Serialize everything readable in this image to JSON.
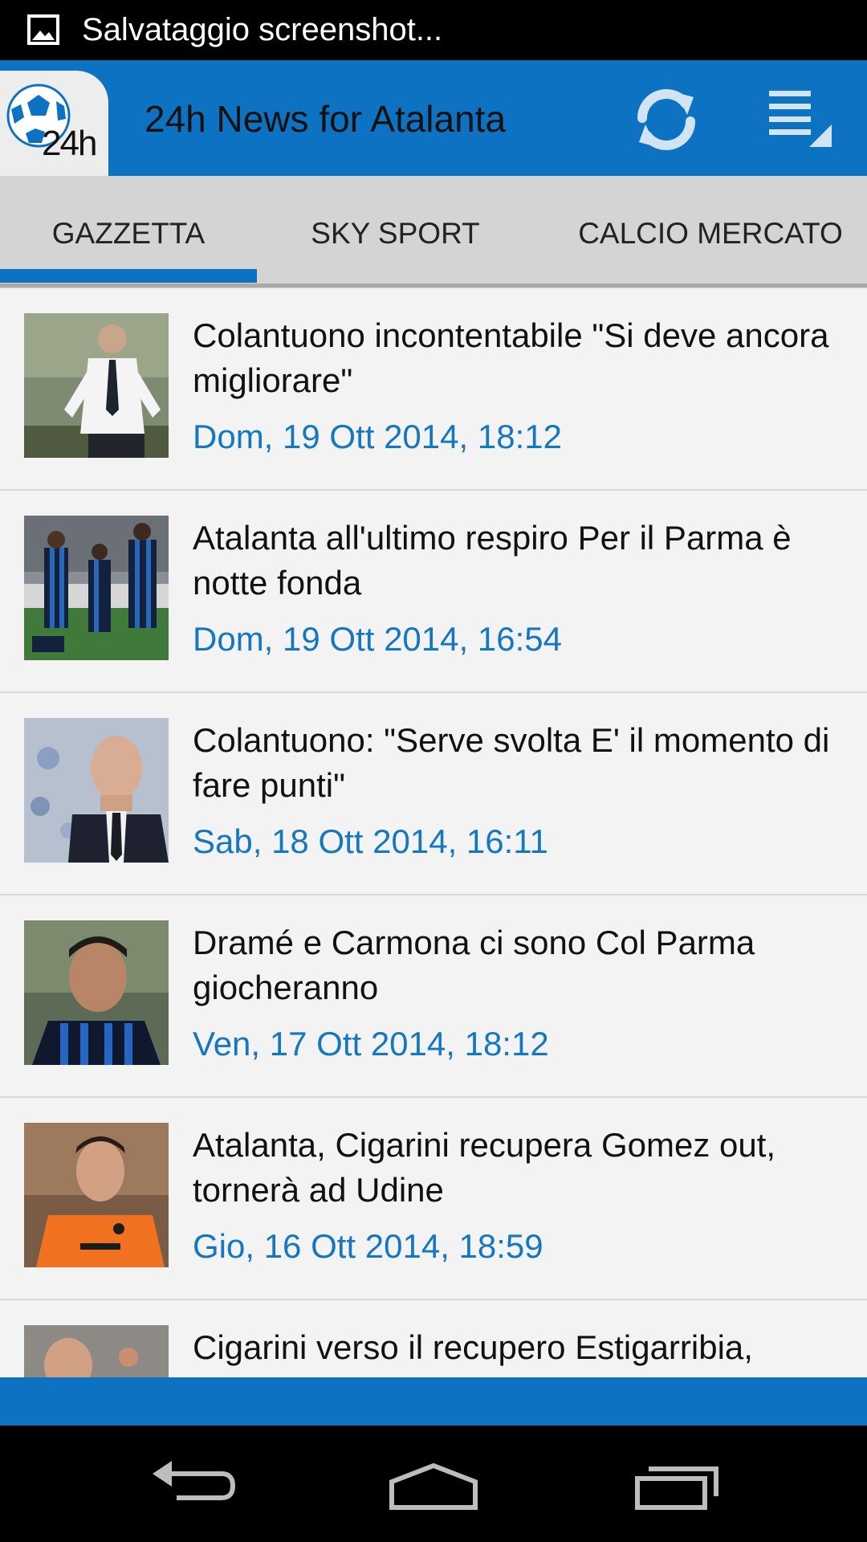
{
  "status_bar": {
    "icon": "image-icon",
    "text": "Salvataggio screenshot..."
  },
  "app_bar": {
    "logo_text": "24h",
    "title": "24h News for Atalanta",
    "refresh_icon": "refresh-icon",
    "menu_icon": "overflow-menu-icon"
  },
  "tabs": [
    {
      "label": "GAZZETTA",
      "selected": true
    },
    {
      "label": "SKY SPORT",
      "selected": false
    },
    {
      "label": "CALCIO MERCATO",
      "selected": false
    }
  ],
  "articles": [
    {
      "headline": " Colantuono incontentabile \"Si deve ancora migliorare\"",
      "date": "Dom, 19 Ott 2014, 18:12"
    },
    {
      "headline": "Atalanta all'ultimo respiro Per il Parma è notte fonda",
      "date": "Dom, 19 Ott 2014, 16:54"
    },
    {
      "headline": "Colantuono: \"Serve svolta E' il momento di fare punti\"",
      "date": "Sab, 18 Ott 2014, 16:11"
    },
    {
      "headline": "Dramé e Carmona ci sono Col Parma giocheranno",
      "date": "Ven, 17 Ott 2014, 18:12"
    },
    {
      "headline": "Atalanta, Cigarini recupera Gomez out, tornerà ad Udine",
      "date": "Gio, 16 Ott 2014, 18:59"
    },
    {
      "headline": "Cigarini verso il recupero  Estigarribia,",
      "date": ""
    }
  ],
  "nav_bar": {
    "back_icon": "back-icon",
    "home_icon": "home-icon",
    "recents_icon": "recents-icon"
  }
}
